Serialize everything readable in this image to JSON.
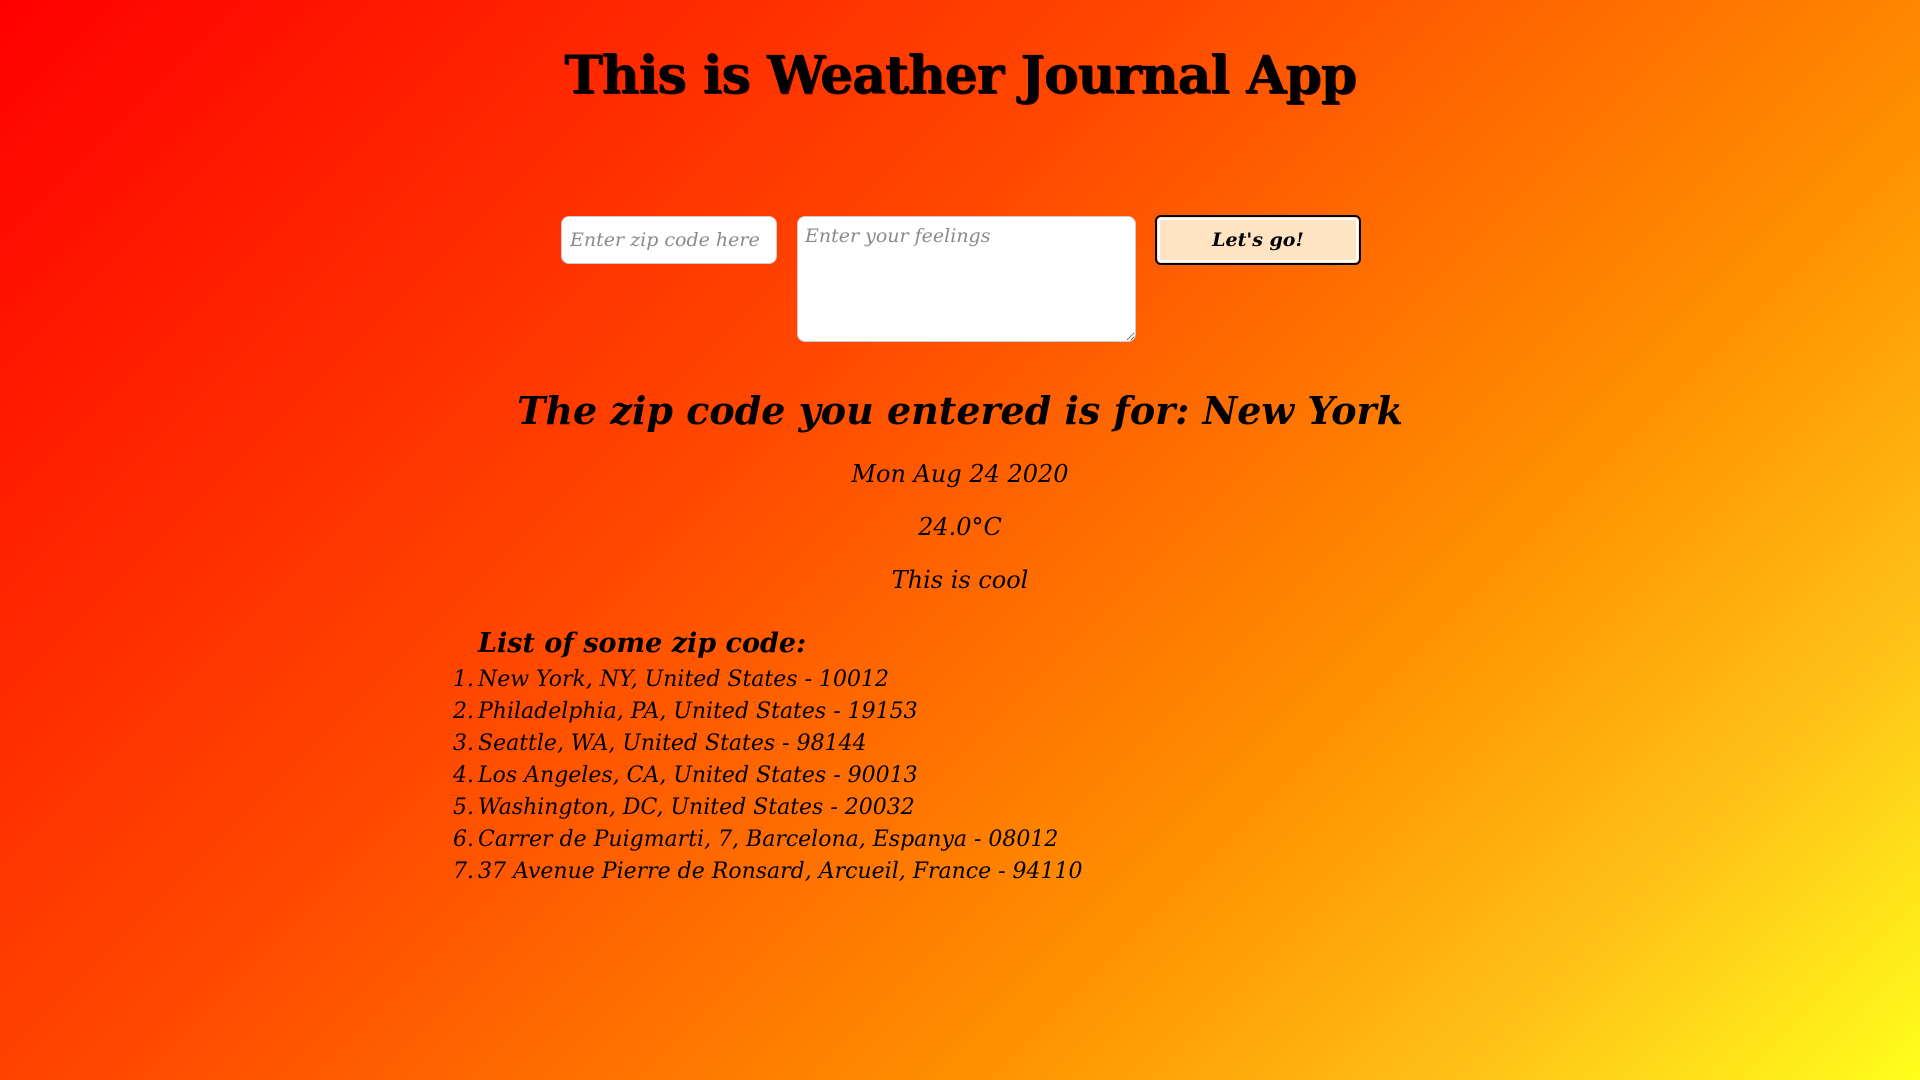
{
  "header": {
    "title": "This is Weather Journal App"
  },
  "form": {
    "zip_placeholder": "Enter zip code here",
    "zip_value": "",
    "feelings_placeholder": "Enter your feelings",
    "feelings_value": "",
    "submit_label": "Let's go!"
  },
  "result": {
    "heading": "The zip code you entered is for: New York",
    "date": "Mon Aug 24 2020",
    "temperature": "24.0°C",
    "content": "This is cool"
  },
  "zip_list": {
    "title": "List of some zip code:",
    "items": [
      {
        "num": "1.",
        "text": "New York, NY, United States - 10012"
      },
      {
        "num": "2.",
        "text": "Philadelphia, PA, United States - 19153"
      },
      {
        "num": "3.",
        "text": "Seattle, WA, United States - 98144"
      },
      {
        "num": "4.",
        "text": "Los Angeles, CA, United States - 90013"
      },
      {
        "num": "5.",
        "text": "Washington, DC, United States - 20032"
      },
      {
        "num": "6.",
        "text": "Carrer de Puigmarti, 7, Barcelona, Espanya - 08012"
      },
      {
        "num": "7.",
        "text": "37 Avenue Pierre de Ronsard, Arcueil, France - 94110"
      }
    ]
  },
  "colors": {
    "gradient_start": "#ff0000",
    "gradient_end": "#ffff1c",
    "button_bg": "#ffe4c4"
  }
}
